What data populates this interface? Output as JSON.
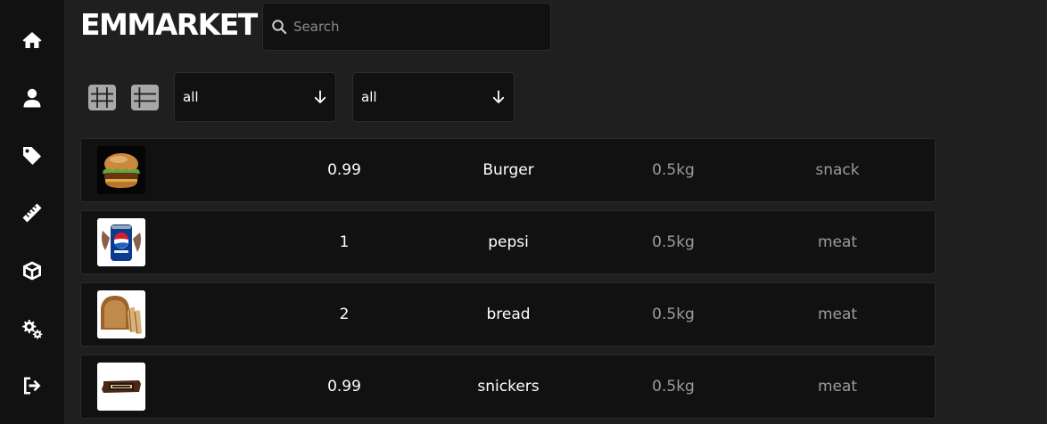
{
  "brand": {
    "title": "EMMARKET"
  },
  "search": {
    "placeholder": "Search",
    "value": ""
  },
  "sidebar": {
    "items": [
      {
        "name": "home",
        "icon": "home-icon"
      },
      {
        "name": "user",
        "icon": "user-icon"
      },
      {
        "name": "tags",
        "icon": "tag-icon"
      },
      {
        "name": "ruler",
        "icon": "ruler-icon"
      },
      {
        "name": "box",
        "icon": "box-icon"
      },
      {
        "name": "settings",
        "icon": "gears-icon"
      },
      {
        "name": "logout",
        "icon": "logout-icon"
      }
    ]
  },
  "toolbar": {
    "grid_view_icon": "grid-icon",
    "list_view_icon": "list-icon",
    "filter1": {
      "value": "all"
    },
    "filter2": {
      "value": "all"
    }
  },
  "products": [
    {
      "image": "burger-image",
      "price": "0.99",
      "name": "Burger",
      "weight": "0.5kg",
      "category": "snack"
    },
    {
      "image": "pepsi-can-image",
      "price": "1",
      "name": "pepsi",
      "weight": "0.5kg",
      "category": "meat"
    },
    {
      "image": "bread-loaf-image",
      "price": "2",
      "name": "bread",
      "weight": "0.5kg",
      "category": "meat"
    },
    {
      "image": "snickers-bar-image",
      "price": "0.99",
      "name": "snickers",
      "weight": "0.5kg",
      "category": "meat"
    }
  ],
  "colors": {
    "background": "#1f1f1f",
    "sidebar": "#111111",
    "card": "#111111",
    "text": "#ffffff",
    "muted_text": "#9b9b9b"
  }
}
